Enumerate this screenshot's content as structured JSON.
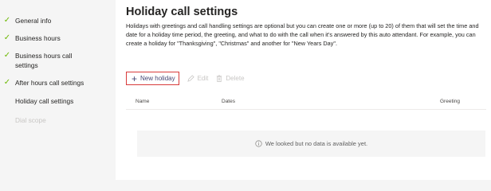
{
  "sidebar": {
    "items": [
      {
        "label": "General info",
        "state": "done"
      },
      {
        "label": "Business hours",
        "state": "done"
      },
      {
        "label": "Business hours call settings",
        "state": "done"
      },
      {
        "label": "After hours call settings",
        "state": "done"
      },
      {
        "label": "Holiday call settings",
        "state": "active"
      },
      {
        "label": "Dial scope",
        "state": "disabled"
      }
    ],
    "check_color": "#6bb700"
  },
  "main": {
    "title": "Holiday call settings",
    "description": "Holidays with greetings and call handling settings are optional but you can create one or more (up to 20) of them that will set the time and date for a holiday time period, the greeting, and what to do with the call when it's answered by this auto attendant. For example, you can create a holiday for \"Thanksgiving\", \"Christmas\" and another for \"New Years Day\".",
    "toolbar": {
      "new_label": "New holiday",
      "edit_label": "Edit",
      "delete_label": "Delete"
    },
    "table": {
      "columns": [
        "Name",
        "Dates",
        "Greeting"
      ],
      "empty_message": "We looked but no data is available yet."
    }
  },
  "colors": {
    "highlight_border": "#d83b3b",
    "accent": "#464775"
  }
}
